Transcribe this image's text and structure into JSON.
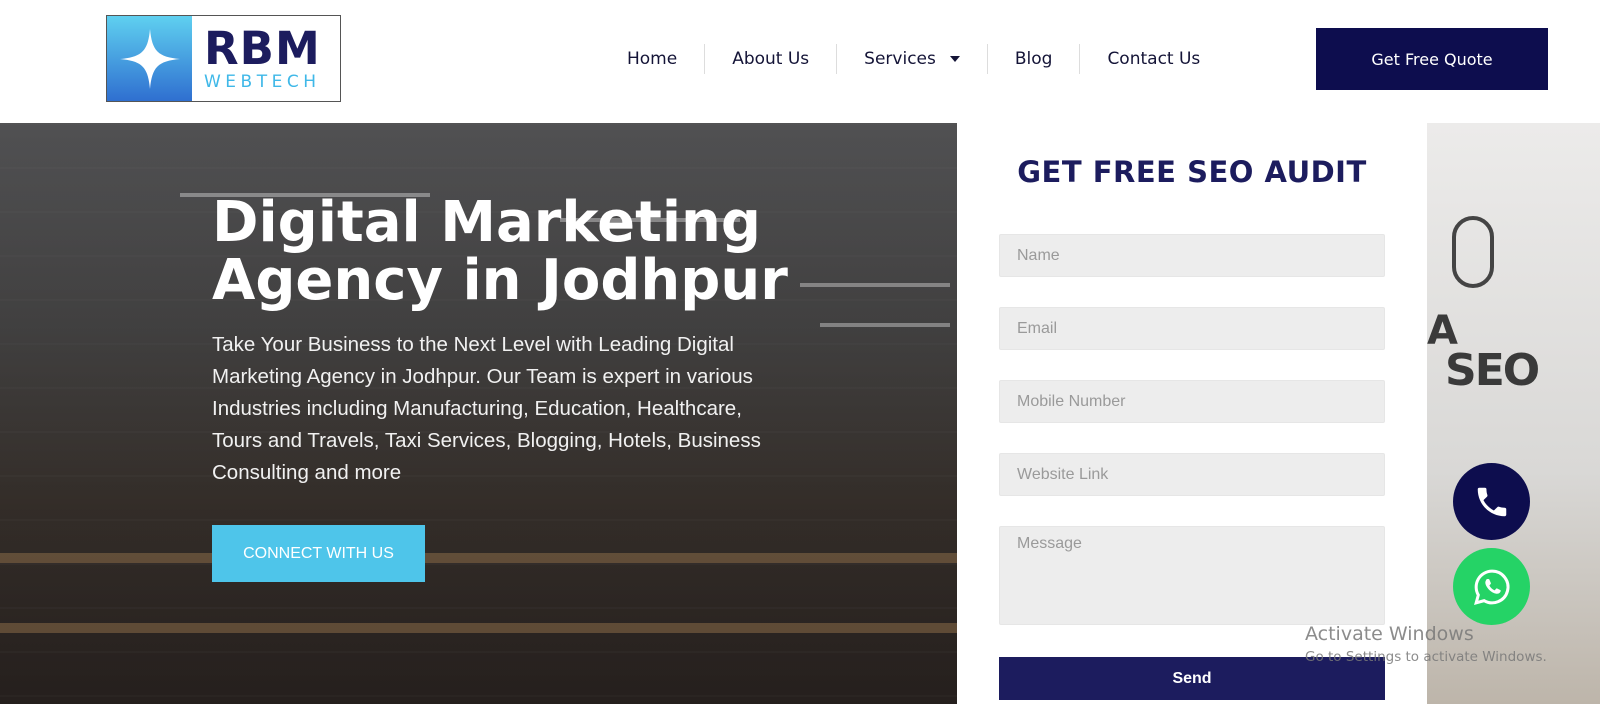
{
  "logo": {
    "brand": "RBM",
    "sub": "WEBTECH"
  },
  "nav": {
    "items": [
      {
        "label": "Home"
      },
      {
        "label": "About Us"
      },
      {
        "label": "Services"
      },
      {
        "label": "Blog"
      },
      {
        "label": "Contact Us"
      }
    ]
  },
  "header": {
    "quote_label": "Get Free Quote"
  },
  "hero": {
    "title_line1": "Digital Marketing",
    "title_line2": "Agency in Jodhpur",
    "text": "Take Your Business to the Next Level with Leading Digital Marketing Agency in Jodhpur. Our Team is expert in various Industries including Manufacturing, Education, Healthcare, Tours and Travels, Taxi Services, Blogging, Hotels, Business Consulting and more",
    "cta_label": "CONNECT WITH US"
  },
  "form": {
    "title": "GET FREE SEO AUDIT",
    "name_placeholder": "Name",
    "email_placeholder": "Email",
    "mobile_placeholder": "Mobile Number",
    "website_placeholder": "Website Link",
    "message_placeholder": "Message",
    "send_label": "Send"
  },
  "side_image": {
    "letter": "A",
    "word": "SEO"
  },
  "floating": {
    "phone_icon": "phone-icon",
    "whatsapp_icon": "whatsapp-icon"
  },
  "watermark": {
    "title": "Activate Windows",
    "subtitle": "Go to Settings to activate Windows."
  },
  "colors": {
    "navy": "#0d0d4e",
    "brand_navy": "#1c1c5e",
    "cyan": "#4ec5ea",
    "whatsapp_green": "#25d366"
  }
}
